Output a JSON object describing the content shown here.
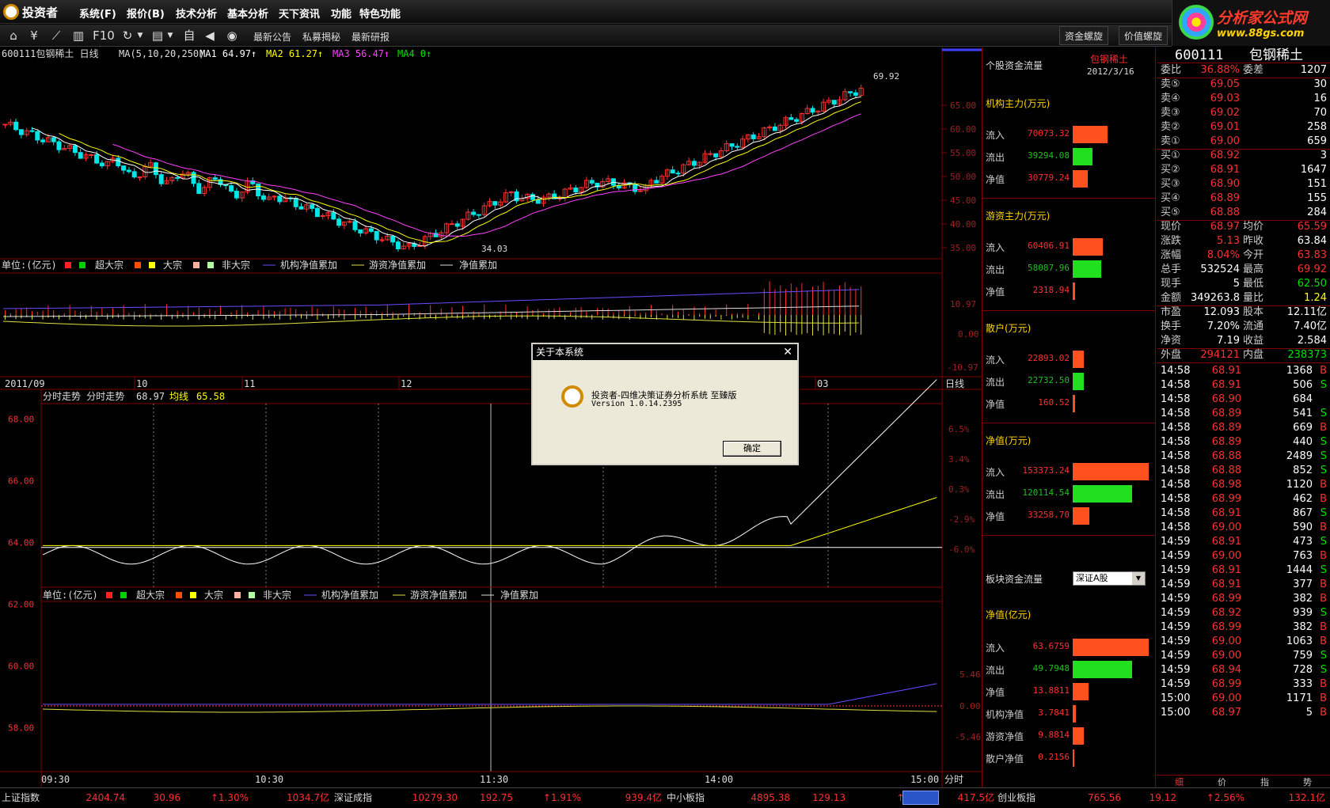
{
  "app": {
    "name": "投资者",
    "menu": [
      "系统(F)",
      "报价(B)",
      "技术分析",
      "基本分析",
      "天下资讯",
      "功能",
      "特色功能"
    ],
    "brand_line1": "分析家公式网",
    "brand_line2": "www.88gs.com"
  },
  "toolbar": {
    "links": [
      "最新公告",
      "私募揭秘",
      "最新研报"
    ],
    "f10": "F10",
    "tabs": [
      "资金螺旋",
      "价值螺旋"
    ]
  },
  "kline": {
    "header": "600111包钢稀土 日线",
    "ma_params": "MA(5,10,20,250)",
    "ma1": "MA1 64.97↑",
    "ma2": "MA2 61.27↑",
    "ma3": "MA3 56.47↑",
    "ma4": "MA4 0↑",
    "high_label": "69.92",
    "low_label": "34.03",
    "y_ticks": [
      "65.00",
      "60.00",
      "55.00",
      "50.00",
      "45.00",
      "40.00",
      "35.00"
    ],
    "x_dates": [
      "2011/09",
      "10",
      "11",
      "12",
      "03"
    ],
    "period": "日线"
  },
  "flow_legend": {
    "unit": "单位:(亿元)",
    "super": "超大宗",
    "big": "大宗",
    "non": "非大宗",
    "inst": "机构净值累加",
    "hot": "游资净值累加",
    "net": "净值累加"
  },
  "flow_ticks": [
    "10.97",
    "0.00",
    "-10.97"
  ],
  "intraday": {
    "header": "分时走势 分时走势",
    "price": "68.97",
    "avg_label": "均线",
    "avg": "65.58",
    "y_ticks": [
      "68.00",
      "66.00",
      "64.00",
      "62.00",
      "60.00",
      "58.00"
    ],
    "pct_ticks": [
      "6.5%",
      "3.4%",
      "0.3%",
      "-2.9%",
      "-6.0%"
    ],
    "times": [
      "09:30",
      "10:30",
      "11:30",
      "14:00",
      "15:00"
    ],
    "period": "分时"
  },
  "intraday_flow_ticks": [
    "5.46",
    "0.00",
    "-5.46"
  ],
  "moneyflow": {
    "title": "个股资金流量",
    "stock": "包钢稀土",
    "date": "2012/3/16",
    "groups": [
      {
        "name": "机构主力(万元)",
        "in": "70073.32",
        "out": "39294.08",
        "net": "30779.24"
      },
      {
        "name": "游资主力(万元)",
        "in": "60406.91",
        "out": "58087.96",
        "net": "2318.94"
      },
      {
        "name": "散户(万元)",
        "in": "22893.02",
        "out": "22732.50",
        "net": "160.52"
      },
      {
        "name": "净值(万元)",
        "in": "153373.24",
        "out": "120114.54",
        "net": "33258.70"
      }
    ],
    "in_label": "流入",
    "out_label": "流出",
    "net_label": "净值",
    "sector_title": "板块资金流量",
    "sector_select": "深证A股",
    "sector": {
      "name": "净值(亿元)",
      "in": "63.6759",
      "out": "49.7948",
      "net": "13.8811",
      "inst_label": "机构净值",
      "inst": "3.7841",
      "hot_label": "游资净值",
      "hot": "9.8814",
      "retail_label": "散户净值",
      "retail": "0.2156"
    }
  },
  "quote": {
    "code": "600111",
    "name": "包钢稀土",
    "weibi_label": "委比",
    "weibi": "36.88%",
    "weicha_label": "委差",
    "weicha": "1207",
    "asks": [
      {
        "l": "卖⑤",
        "p": "69.05",
        "v": "30"
      },
      {
        "l": "卖④",
        "p": "69.03",
        "v": "16"
      },
      {
        "l": "卖③",
        "p": "69.02",
        "v": "70"
      },
      {
        "l": "卖②",
        "p": "69.01",
        "v": "258"
      },
      {
        "l": "卖①",
        "p": "69.00",
        "v": "659"
      }
    ],
    "bids": [
      {
        "l": "买①",
        "p": "68.92",
        "v": "3"
      },
      {
        "l": "买②",
        "p": "68.91",
        "v": "1647"
      },
      {
        "l": "买③",
        "p": "68.90",
        "v": "151"
      },
      {
        "l": "买④",
        "p": "68.89",
        "v": "155"
      },
      {
        "l": "买⑤",
        "p": "68.88",
        "v": "284"
      }
    ],
    "stats": [
      {
        "a": "现价",
        "av": "68.97",
        "b": "均价",
        "bv": "65.59"
      },
      {
        "a": "涨跌",
        "av": "5.13",
        "b": "昨收",
        "bv": "63.84"
      },
      {
        "a": "涨幅",
        "av": "8.04%",
        "b": "今开",
        "bv": "63.83"
      },
      {
        "a": "总手",
        "av": "532524",
        "b": "最高",
        "bv": "69.92"
      },
      {
        "a": "现手",
        "av": "5",
        "b": "最低",
        "bv": "62.50"
      },
      {
        "a": "金额",
        "av": "349263.8",
        "b": "量比",
        "bv": "1.24"
      },
      {
        "a": "市盈",
        "av": "12.093",
        "b": "股本",
        "bv": "12.11亿"
      },
      {
        "a": "换手",
        "av": "7.20%",
        "b": "流通",
        "bv": "7.40亿"
      },
      {
        "a": "净资",
        "av": "7.19",
        "b": "收益",
        "bv": "2.584"
      }
    ],
    "waipan_label": "外盘",
    "waipan": "294121",
    "neipan_label": "内盘",
    "neipan": "238373",
    "ticks": [
      [
        "14:58",
        "68.91",
        "1368",
        "B"
      ],
      [
        "14:58",
        "68.91",
        "506",
        "S"
      ],
      [
        "14:58",
        "68.90",
        "684",
        ""
      ],
      [
        "14:58",
        "68.89",
        "541",
        "S"
      ],
      [
        "14:58",
        "68.89",
        "669",
        "B"
      ],
      [
        "14:58",
        "68.89",
        "440",
        "S"
      ],
      [
        "14:58",
        "68.88",
        "2489",
        "S"
      ],
      [
        "14:58",
        "68.88",
        "852",
        "S"
      ],
      [
        "14:58",
        "68.98",
        "1120",
        "B"
      ],
      [
        "14:58",
        "68.99",
        "462",
        "B"
      ],
      [
        "14:58",
        "68.91",
        "867",
        "S"
      ],
      [
        "14:58",
        "69.00",
        "590",
        "B"
      ],
      [
        "14:59",
        "68.91",
        "473",
        "S"
      ],
      [
        "14:59",
        "69.00",
        "763",
        "B"
      ],
      [
        "14:59",
        "68.91",
        "1444",
        "S"
      ],
      [
        "14:59",
        "68.91",
        "377",
        "B"
      ],
      [
        "14:59",
        "68.99",
        "382",
        "B"
      ],
      [
        "14:59",
        "68.92",
        "939",
        "S"
      ],
      [
        "14:59",
        "68.99",
        "382",
        "B"
      ],
      [
        "14:59",
        "69.00",
        "1063",
        "B"
      ],
      [
        "14:59",
        "69.00",
        "759",
        "S"
      ],
      [
        "14:59",
        "68.94",
        "728",
        "S"
      ],
      [
        "14:59",
        "68.99",
        "333",
        "B"
      ],
      [
        "15:00",
        "69.00",
        "1171",
        "B"
      ],
      [
        "15:00",
        "68.97",
        "5",
        "B"
      ]
    ],
    "bottom_tabs": [
      "细",
      "价",
      "指",
      "势"
    ]
  },
  "status": [
    {
      "name": "上证指数",
      "v1": "2404.74",
      "v2": "30.96",
      "v3": "↑1.30%",
      "v4": "1034.7亿"
    },
    {
      "name": "深证成指",
      "v1": "10279.30",
      "v2": "192.75",
      "v3": "↑1.91%",
      "v4": "939.4亿"
    },
    {
      "name": "中小板指",
      "v1": "4895.38",
      "v2": "129.13",
      "v3": "↑2.",
      "v4": "417.5亿"
    },
    {
      "name": "创业板指",
      "v1": "765.56",
      "v2": "19.12",
      "v3": "↑2.56%",
      "v4": "132.1亿"
    }
  ],
  "dialog": {
    "title": "关于本系统",
    "line1": "投资者-四维决策证券分析系统 至臻版",
    "line2": "Version 1.0.14.2395",
    "ok": "确定"
  }
}
